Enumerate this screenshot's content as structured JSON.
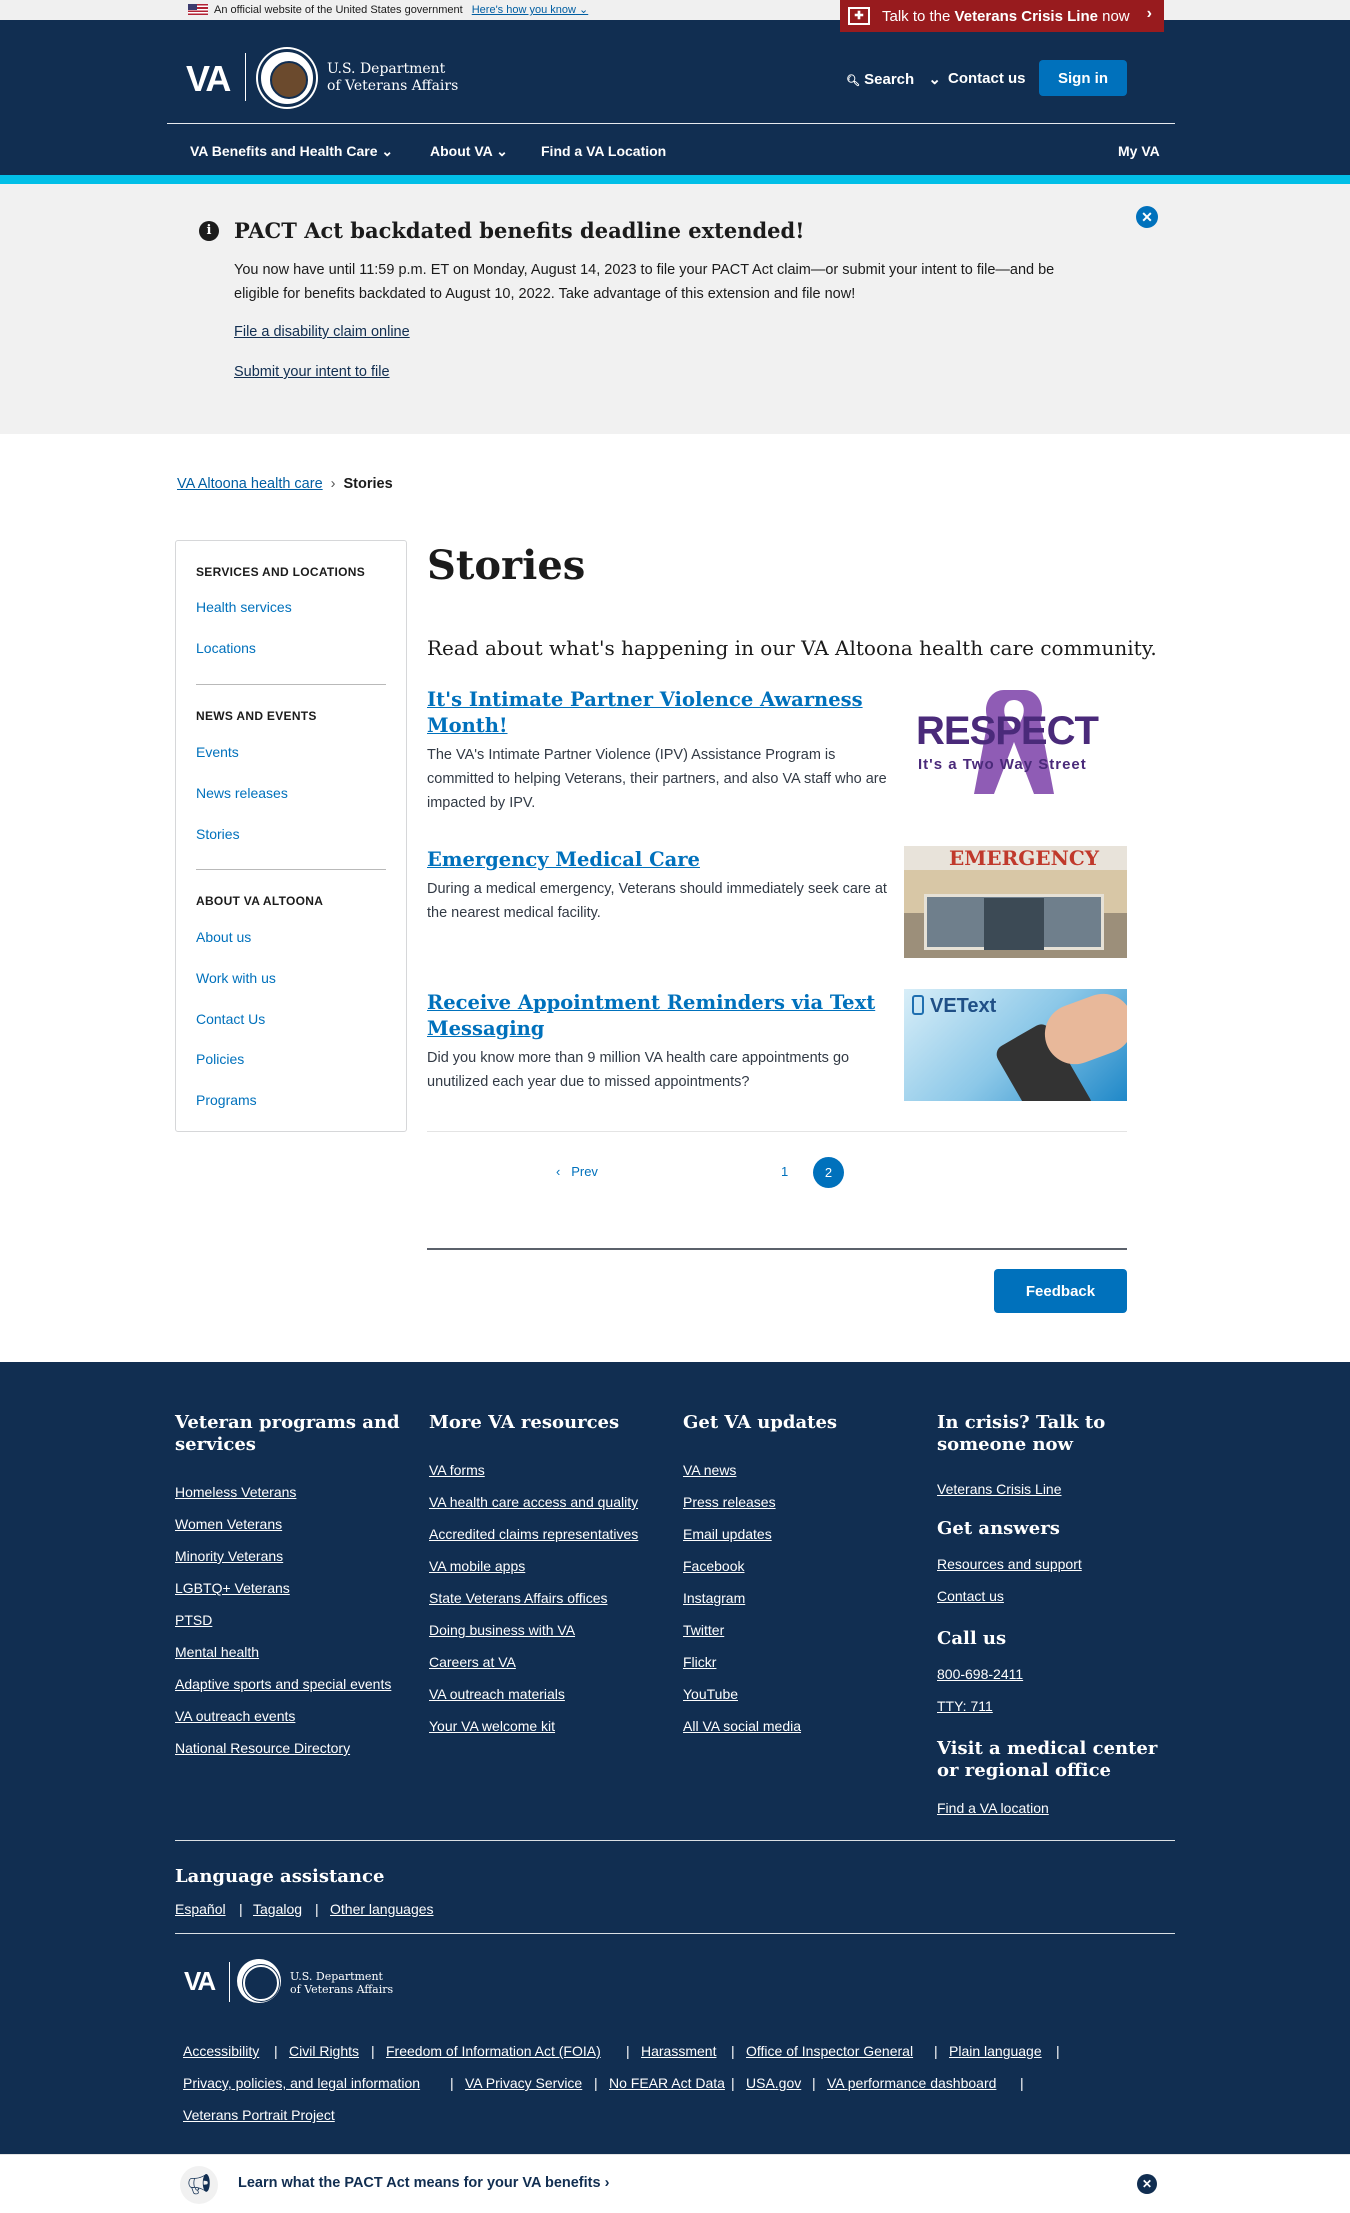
{
  "gov_banner": {
    "text": "An official website of the United States government",
    "how_link": "Here's how you know"
  },
  "crisis": {
    "prefix": "Talk to the",
    "bold": "Veterans Crisis Line",
    "suffix": "now",
    "icon_text": "✚"
  },
  "header": {
    "logo_text": "VA",
    "dept_line1": "U.S. Department",
    "dept_line2": "of Veterans Affairs",
    "search": "Search",
    "contact": "Contact us",
    "signin": "Sign in",
    "nav": [
      "VA Benefits and Health Care",
      "About VA",
      "Find a VA Location",
      "My VA"
    ]
  },
  "alert": {
    "title": "PACT Act backdated benefits deadline extended!",
    "body": "You now have until 11:59 p.m. ET on Monday, August 14, 2023 to file your PACT Act claim—or submit your intent to file—and be eligible for benefits backdated to August 10, 2022. Take advantage of this extension and file now!",
    "link1": "File a disability claim online",
    "link2": "Submit your intent to file"
  },
  "breadcrumb": {
    "parent": "VA Altoona health care",
    "current": "Stories"
  },
  "sidebar": {
    "sections": [
      {
        "heading": "SERVICES AND LOCATIONS",
        "items": [
          "Health services",
          "Locations"
        ]
      },
      {
        "heading": "NEWS AND EVENTS",
        "items": [
          "Events",
          "News releases",
          "Stories"
        ]
      },
      {
        "heading": "ABOUT VA ALTOONA",
        "items": [
          "About us",
          "Work with us",
          "Contact Us",
          "Policies",
          "Programs"
        ]
      }
    ]
  },
  "main": {
    "title": "Stories",
    "intro": "Read about what's happening in our VA Altoona health care community.",
    "stories": [
      {
        "title": "It's Intimate Partner Violence Awarness Month!",
        "desc": "The VA's Intimate Partner Violence (IPV) Assistance Program is committed to helping Veterans, their partners, and also VA staff who are impacted by IPV.",
        "thumb_main": "RESPECT",
        "thumb_sub": "It's a Two Way Street"
      },
      {
        "title": "Emergency Medical Care",
        "desc": "During a medical emergency, Veterans should immediately seek care at the nearest medical facility.",
        "thumb_main": "EMERGENCY"
      },
      {
        "title": "Receive Appointment Reminders via Text Messaging",
        "desc": "Did you know more than 9 million VA health care appointments go unutilized each year due to missed appointments?",
        "thumb_main": "VEText"
      }
    ],
    "pagination": {
      "prev": "Prev",
      "pages": [
        "1",
        "2"
      ],
      "current": "2"
    },
    "feedback": "Feedback"
  },
  "footer": {
    "columns": [
      {
        "heading": "Veteran programs and services",
        "links": [
          "Homeless Veterans",
          "Women Veterans",
          "Minority Veterans",
          "LGBTQ+ Veterans",
          "PTSD",
          "Mental health",
          "Adaptive sports and special events",
          "VA outreach events",
          "National Resource Directory"
        ]
      },
      {
        "heading": "More VA resources",
        "links": [
          "VA forms",
          "VA health care access and quality",
          "Accredited claims representatives",
          "VA mobile apps",
          "State Veterans Affairs offices",
          "Doing business with VA",
          "Careers at VA",
          "VA outreach materials",
          "Your VA welcome kit"
        ]
      },
      {
        "heading": "Get VA updates",
        "links": [
          "VA news",
          "Press releases",
          "Email updates",
          "Facebook",
          "Instagram",
          "Twitter",
          "Flickr",
          "YouTube",
          "All VA social media"
        ]
      }
    ],
    "crisis_heading": "In crisis? Talk to someone now",
    "crisis_link": "Veterans Crisis Line",
    "answers_heading": "Get answers",
    "answers_links": [
      "Resources and support",
      "Contact us"
    ],
    "call_heading": "Call us",
    "call_links": [
      "800-698-2411",
      "TTY: 711"
    ],
    "visit_heading": "Visit a medical center or regional office",
    "visit_link": "Find a VA location",
    "language_heading": "Language assistance",
    "languages": [
      "Español",
      "Tagalog",
      "Other languages"
    ],
    "logo_text": "VA",
    "dept_line1": "U.S. Department",
    "dept_line2": "of Veterans Affairs",
    "bottom_links_row1": [
      "Accessibility",
      "Civil Rights",
      "Freedom of Information Act (FOIA)",
      "Harassment",
      "Office of Inspector General",
      "Plain language"
    ],
    "bottom_links_row2": [
      "Privacy, policies, and legal information",
      "VA Privacy Service",
      "No FEAR Act Data",
      "USA.gov",
      "VA performance dashboard"
    ],
    "bottom_links_row3": [
      "Veterans Portrait Project"
    ]
  },
  "bottom_banner": {
    "text": "Learn what the PACT Act means for your VA benefits ›"
  },
  "colors": {
    "primary": "#0071bc",
    "navy": "#112e51",
    "crisis": "#981b1e",
    "stripe": "#02bfe7"
  }
}
